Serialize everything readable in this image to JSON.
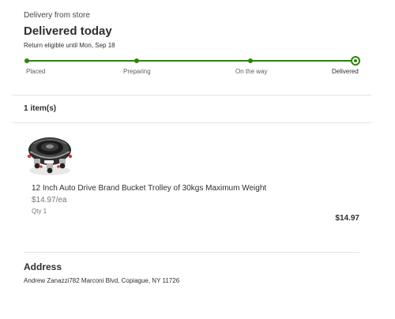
{
  "order": {
    "delivery_type": "Delivery from store",
    "status_title": "Delivered today",
    "return_note": "Return eligible until Mon, Sep 18"
  },
  "tracker": {
    "steps": [
      {
        "label": "Placed"
      },
      {
        "label": "Preparing"
      },
      {
        "label": "On the way"
      },
      {
        "label": "Delivered"
      }
    ],
    "current_step_index": 3,
    "color": "#2a8703"
  },
  "items": {
    "count_label": "1 item(s)",
    "list": [
      {
        "image_icon": "product-bucket-trolley-image",
        "name": "12 Inch Auto Drive Brand Bucket Trolley of 30kgs Maximum Weight",
        "unit_price": "$14.97/ea",
        "qty": "Qty 1",
        "total": "$14.97"
      }
    ]
  },
  "address": {
    "title": "Address",
    "text": "Andrew Zanazzi782 Marconi Blvd, Copiague, NY 11726"
  }
}
